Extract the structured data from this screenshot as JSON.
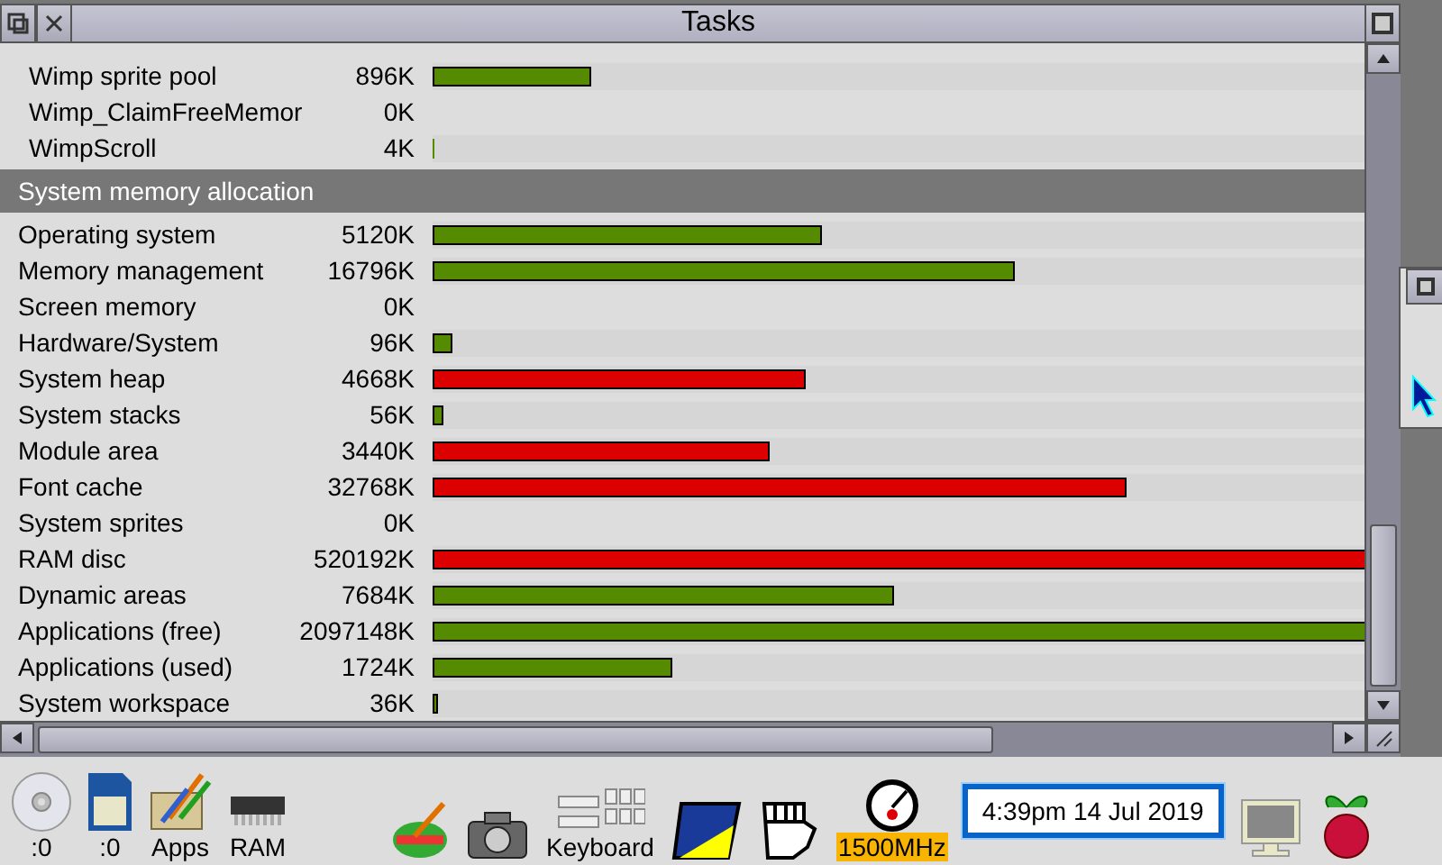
{
  "window": {
    "title": "Tasks"
  },
  "module_rows": [
    {
      "name": "Wimp sprite pool",
      "size": "896K",
      "level": 0.17,
      "color": "#558b00"
    },
    {
      "name": "Wimp_ClaimFreeMemor",
      "size": "0K"
    },
    {
      "name": "WimpScroll",
      "size": "4K",
      "level": 0.002,
      "color": "#558b00"
    }
  ],
  "section": {
    "title": "System memory allocation"
  },
  "system_rows": [
    {
      "name": "Operating system",
      "size": "5120K",
      "level": 0.418,
      "color": "#558b00"
    },
    {
      "name": "Memory management",
      "size": "16796K",
      "level": 0.625,
      "color": "#558b00"
    },
    {
      "name": "Screen memory",
      "size": "0K"
    },
    {
      "name": "Hardware/System",
      "size": "96K",
      "level": 0.021,
      "color": "#558b00"
    },
    {
      "name": "System heap",
      "size": "4668K",
      "level": 0.4,
      "color": "#dd0000"
    },
    {
      "name": "System stacks",
      "size": "56K",
      "level": 0.012,
      "color": "#558b00"
    },
    {
      "name": "Module area",
      "size": "3440K",
      "level": 0.362,
      "color": "#dd0000"
    },
    {
      "name": "Font cache",
      "size": "32768K",
      "level": 0.745,
      "color": "#dd0000"
    },
    {
      "name": "System sprites",
      "size": "0K"
    },
    {
      "name": "RAM disc",
      "size": "520192K",
      "level": 1,
      "color": "#dd0000"
    },
    {
      "name": "Dynamic areas",
      "size": "7684K",
      "level": 0.495,
      "color": "#558b00"
    },
    {
      "name": "Applications (free)",
      "size": "2097148K",
      "level": 1,
      "color": "#558b00"
    },
    {
      "name": "Applications (used)",
      "size": "1724K",
      "level": 0.257,
      "color": "#558b00"
    },
    {
      "name": "System workspace",
      "size": "36K",
      "level": 0.006,
      "color": "#558b00"
    }
  ],
  "iconbar": {
    "left": [
      {
        "kind": "cd",
        "label": ":0"
      },
      {
        "kind": "sd",
        "label": ":0"
      },
      {
        "kind": "apps",
        "label": "Apps"
      },
      {
        "kind": "ram",
        "label": "RAM"
      }
    ],
    "right": [
      {
        "kind": "paint"
      },
      {
        "kind": "camera"
      },
      {
        "kind": "keyboard",
        "label": "Keyboard"
      },
      {
        "kind": "draw"
      },
      {
        "kind": "fist"
      },
      {
        "kind": "cpu",
        "label": "1500MHz"
      },
      {
        "kind": "clock",
        "label": "4:39pm 14 Jul 2019"
      },
      {
        "kind": "monitor"
      },
      {
        "kind": "raspberry"
      }
    ]
  }
}
